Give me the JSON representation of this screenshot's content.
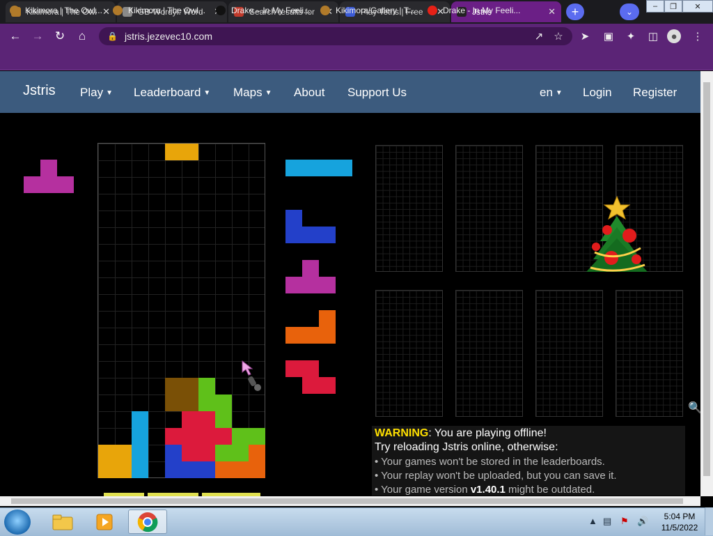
{
  "browser": {
    "tabs": [
      {
        "title": "Kikimora | The Owl House",
        "favicon_color": "#b07a2a"
      },
      {
        "title": "GB-Wordyl: Word",
        "favicon_color": "#8a8a8a"
      },
      {
        "title": "Search results for",
        "favicon_color": "#c0392b"
      },
      {
        "title": "Play Tetris | Free",
        "favicon_color": "#3b5bd6"
      },
      {
        "title": "Jstris",
        "favicon_color": "#222222",
        "active": true
      }
    ],
    "new_tab": "+",
    "tab_search": "⌄",
    "window_controls": [
      "–",
      "❐",
      "✕"
    ],
    "url": "jstris.jezevec10.com",
    "bookmarks": [
      {
        "label": "Kikimora | The Owl...",
        "icon_color": "#b07a2a"
      },
      {
        "label": "Kikimora | The Owl...",
        "icon_color": "#b07a2a"
      },
      {
        "label": "Drake – In My Feeli...",
        "icon_color": "#111111"
      },
      {
        "label": "Kikimora/Gallery | T...",
        "icon_color": "#b07a2a"
      },
      {
        "label": "Drake - In My Feeli...",
        "icon_color": "#e62117"
      }
    ]
  },
  "site": {
    "brand": "Jstris",
    "nav": [
      {
        "label": "Play",
        "dropdown": true
      },
      {
        "label": "Leaderboard",
        "dropdown": true
      },
      {
        "label": "Maps",
        "dropdown": true
      },
      {
        "label": "About",
        "dropdown": false
      },
      {
        "label": "Support Us",
        "dropdown": false
      }
    ],
    "lang": "en",
    "login": "Login",
    "register": "Register"
  },
  "game": {
    "colors": {
      "T": "#b5309f",
      "I": "#16a3dd",
      "J": "#2340c9",
      "L": "#e8620c",
      "Z": "#dc1a3c",
      "S": "#5fc01a",
      "O": "#e8a50a",
      "G": "#7a5006"
    },
    "hold": "T",
    "queue": [
      "I",
      "J",
      "T",
      "L",
      "Z"
    ]
  },
  "warning": {
    "tag": "WARNING",
    "line1": ": You are playing offline!",
    "line2": "Try reloading Jstris online, otherwise:",
    "items": [
      "• Your games won't be stored in the leaderboards.",
      "• Your replay won't be uploaded, but you can save it."
    ],
    "item3_prefix": "• Your game version ",
    "item3_version": "v1.40.1",
    "item3_suffix": " might be outdated."
  },
  "taskbar": {
    "time": "5:04 PM",
    "date": "11/5/2022"
  }
}
